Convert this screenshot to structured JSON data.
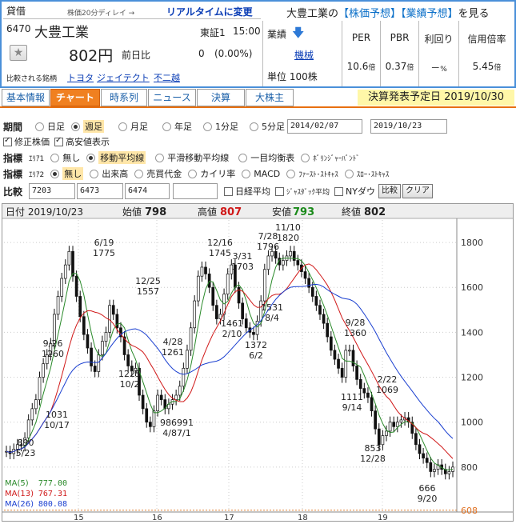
{
  "header": {
    "kashi": "貸借",
    "delay": "株価20分ディレイ → ",
    "realtime": "リアルタイムに変更",
    "code": "6470",
    "name": "大豊工業",
    "market": "東証1",
    "time": "15:00",
    "price": "802円",
    "prev_label": "前日比",
    "change": "0",
    "change_pct": "(0.00%)",
    "compare_label": "比較される銘柄",
    "compare": [
      "トヨタ",
      "ジェイテクト",
      "不二越"
    ],
    "see_prefix": "大豊工業の",
    "forecast_link": "【株価予想】",
    "earnings_link": "【業績予想】",
    "see_suffix": "を見る",
    "gyoseki": "業績",
    "industry": "機械",
    "unit": "単位 100株",
    "metrics": [
      {
        "label": "PER",
        "value": "10.6",
        "unit": "倍"
      },
      {
        "label": "PBR",
        "value": "0.37",
        "unit": "倍"
      },
      {
        "label": "利回り",
        "value": "－",
        "unit": "%"
      },
      {
        "label": "信用倍率",
        "value": "5.45",
        "unit": "倍"
      }
    ]
  },
  "tabs": [
    "基本情報",
    "チャート",
    "時系列",
    "ニュース",
    "決算",
    "大株主"
  ],
  "earnings_date": "決算発表予定日  2019/10/30",
  "period": {
    "label": "期間",
    "options": [
      "日足",
      "週足",
      "月足",
      "年足",
      "1分足",
      "5分足"
    ],
    "selected": "週足",
    "from": "2014/02/07",
    "to": "2019/10/23"
  },
  "checks": [
    {
      "label": "修正株価",
      "on": true
    },
    {
      "label": "高安値表示",
      "on": true
    }
  ],
  "ind1": {
    "label": "指標",
    "area": "ｴﾘｱ1",
    "options": [
      "無し",
      "移動平均線",
      "平滑移動平均線",
      "一目均衡表",
      "ﾎﾞﾘﾝｼﾞｬｰﾊﾞﾝﾄﾞ"
    ],
    "selected": "移動平均線"
  },
  "ind2": {
    "label": "指標",
    "area": "ｴﾘｱ2",
    "options": [
      "無し",
      "出来高",
      "売買代金",
      "カイリ率",
      "MACD",
      "ﾌｧｰｽﾄ･ｽﾄｷｬｽ",
      "ｽﾛｰ･ｽﾄｷｬｽ"
    ],
    "selected": "無し"
  },
  "compare": {
    "label": "比較",
    "codes": [
      "7203",
      "6473",
      "6474",
      ""
    ],
    "checks": [
      "日経平均",
      "ｼﾞｬｽﾀﾞｯｸ平均",
      "NYダウ"
    ],
    "btn_compare": "比較",
    "btn_clear": "クリア"
  },
  "chart_data": {
    "type": "candlestick",
    "info": {
      "date_label": "日付",
      "date": "2019/10/23",
      "open_label": "始値",
      "open": "798",
      "high_label": "高値",
      "high": "807",
      "low_label": "安値",
      "low": "793",
      "close_label": "終値",
      "close": "802"
    },
    "ylim": [
      600,
      1900
    ],
    "yticks": [
      800,
      1000,
      1200,
      1400,
      1600,
      1800
    ],
    "xticks": [
      "15",
      "16",
      "17",
      "18",
      "19"
    ],
    "min_line": "608",
    "closes": [
      870,
      860,
      880,
      900,
      895,
      930,
      1010,
      1060,
      1100,
      1200,
      1260,
      1300,
      1350,
      1480,
      1560,
      1640,
      1700,
      1760,
      1650,
      1560,
      1470,
      1390,
      1330,
      1250,
      1225,
      1300,
      1360,
      1400,
      1520,
      1480,
      1420,
      1380,
      1300,
      1250,
      1230,
      1240,
      1120,
      1060,
      1000,
      980,
      1050,
      1120,
      1100,
      1060,
      1080,
      1100,
      1120,
      1160,
      1240,
      1320,
      1420,
      1540,
      1650,
      1690,
      1660,
      1600,
      1520,
      1460,
      1480,
      1570,
      1660,
      1700,
      1600,
      1530,
      1460,
      1420,
      1400,
      1390,
      1450,
      1540,
      1680,
      1740,
      1760,
      1730,
      1700,
      1720,
      1740,
      1760,
      1720,
      1700,
      1670,
      1640,
      1600,
      1560,
      1520,
      1480,
      1440,
      1380,
      1320,
      1280,
      1240,
      1200,
      1320,
      1320,
      1250,
      1190,
      1150,
      1130,
      1110,
      1050,
      970,
      900,
      940,
      960,
      1000,
      980,
      1000,
      1010,
      1020,
      1000,
      950,
      900,
      860,
      840,
      820,
      780,
      790,
      810,
      790,
      770,
      780,
      800
    ],
    "highs": [
      {
        "label": "6/19",
        "value": "1775"
      },
      {
        "label": "12/25",
        "value": "1557"
      },
      {
        "label": "4/28",
        "value": "1261"
      },
      {
        "label": "9/26",
        "value": "1260"
      },
      {
        "label": "12/16",
        "value": "1745"
      },
      {
        "label": "3/31",
        "value": "1703"
      },
      {
        "label": "7/28",
        "value": "1796"
      },
      {
        "label": "11/10",
        "value": "1820"
      },
      {
        "label": "1461",
        "value": "2/10"
      },
      {
        "label": "1531",
        "value": "8/4"
      },
      {
        "label": "9/28",
        "value": "1360"
      },
      {
        "label": "2/22",
        "value": "1069"
      }
    ],
    "lows": [
      {
        "label": "1225",
        "value": "10/2"
      },
      {
        "label": "1031",
        "value": "10/17"
      },
      {
        "label": "890",
        "value": "5/23"
      },
      {
        "label": "986991",
        "value": "4/87/1"
      },
      {
        "label": "1372",
        "value": "6/2"
      },
      {
        "label": "1111",
        "value": "9/14"
      },
      {
        "label": "853",
        "value": "12/28"
      },
      {
        "label": "666",
        "value": "9/20"
      }
    ],
    "ma": [
      {
        "name": "MA(5)",
        "value": "777.00",
        "color": "#2a8a2a"
      },
      {
        "name": "MA(13)",
        "value": "767.31",
        "color": "#d01818"
      },
      {
        "name": "MA(26)",
        "value": "800.08",
        "color": "#1a3fd0"
      }
    ]
  }
}
